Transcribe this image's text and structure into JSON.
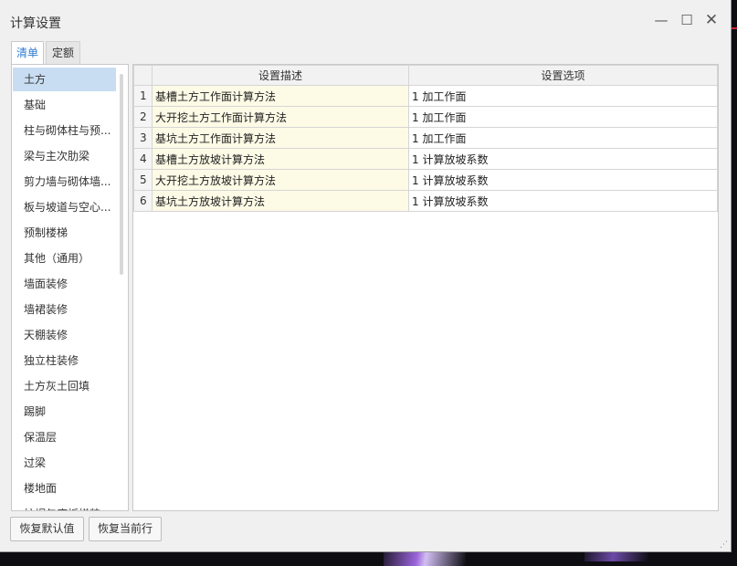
{
  "window": {
    "title": "计算设置",
    "minimize_glyph": "—",
    "maximize_glyph": "☐",
    "close_glyph": "✕"
  },
  "tabs": [
    {
      "label": "清单",
      "active": true
    },
    {
      "label": "定额",
      "active": false
    }
  ],
  "categories": [
    {
      "label": "土方",
      "selected": true
    },
    {
      "label": "基础"
    },
    {
      "label": "柱与砌体柱与预..."
    },
    {
      "label": "梁与主次肋梁"
    },
    {
      "label": "剪力墙与砌体墙..."
    },
    {
      "label": "板与坡道与空心..."
    },
    {
      "label": "预制楼梯"
    },
    {
      "label": "其他（通用）"
    },
    {
      "label": "墙面装修"
    },
    {
      "label": "墙裙装修"
    },
    {
      "label": "天棚装修"
    },
    {
      "label": "独立柱装修"
    },
    {
      "label": "土方灰土回填"
    },
    {
      "label": "踢脚"
    },
    {
      "label": "保温层"
    },
    {
      "label": "过梁"
    },
    {
      "label": "楼地面"
    },
    {
      "label": "柱帽与底板梯装"
    }
  ],
  "grid": {
    "columns": [
      "设置描述",
      "设置选项"
    ],
    "rows": [
      {
        "no": "1",
        "desc": "基槽土方工作面计算方法",
        "option": "1 加工作面"
      },
      {
        "no": "2",
        "desc": "大开挖土方工作面计算方法",
        "option": "1 加工作面"
      },
      {
        "no": "3",
        "desc": "基坑土方工作面计算方法",
        "option": "1 加工作面"
      },
      {
        "no": "4",
        "desc": "基槽土方放坡计算方法",
        "option": "1 计算放坡系数"
      },
      {
        "no": "5",
        "desc": "大开挖土方放坡计算方法",
        "option": "1 计算放坡系数"
      },
      {
        "no": "6",
        "desc": "基坑土方放坡计算方法",
        "option": "1 计算放坡系数"
      }
    ]
  },
  "buttons": {
    "restore_default": "恢复默认值",
    "restore_current_row": "恢复当前行"
  },
  "colors": {
    "tab_active": "#2f7bd2",
    "selected_item": "#c9ddf2",
    "desc_cell": "#fdfae6"
  }
}
